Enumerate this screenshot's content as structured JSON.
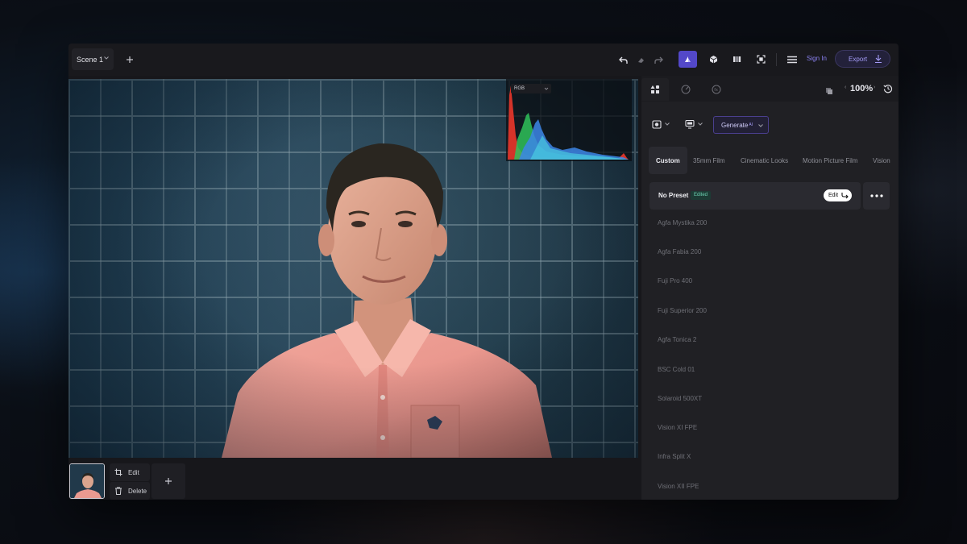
{
  "toolbar": {
    "scene_label": "Scene 1",
    "sign_in": "Sign In",
    "export": "Export"
  },
  "histogram": {
    "channel": "RGB"
  },
  "filmstrip": {
    "edit_label": "Edit",
    "delete_label": "Delete"
  },
  "panel": {
    "zoom": "100%",
    "generate_label": "Generate",
    "generate_badge": "AI",
    "categories": [
      "Custom",
      "35mm Film",
      "Cinematic Looks",
      "Motion Picture Film",
      "Vision"
    ],
    "active_preset": {
      "name": "No Preset",
      "badge": "Edited",
      "edit_label": "Edit"
    },
    "presets": [
      "Agfa Mystika 200",
      "Agfa Fabia 200",
      "Fuji Pro 400",
      "Fuji Superior 200",
      "Agfa Tonica 2",
      "BSC Cold 01",
      "Solaroid 500XT",
      "Vision XI FPE",
      "Infra Split X",
      "Vision XII FPE"
    ]
  },
  "icons": {
    "accent": "#5348c9",
    "link": "#8b82f2"
  }
}
